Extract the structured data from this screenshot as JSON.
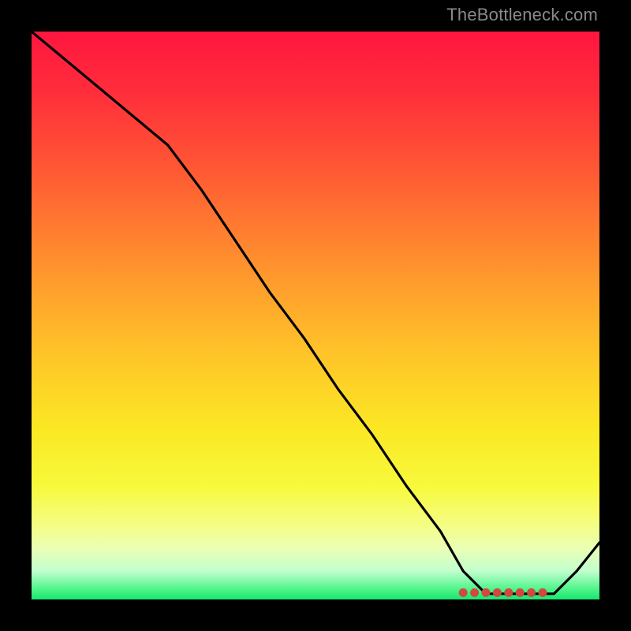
{
  "attribution": "TheBottleneck.com",
  "colors": {
    "frame_bg": "#000000",
    "curve_stroke": "#000000",
    "marker_stroke": "#d1493e",
    "marker_fill": "#d1493e",
    "attribution_text": "#8a8a8a"
  },
  "chart_data": {
    "type": "line",
    "title": "",
    "xlabel": "",
    "ylabel": "",
    "xlim": [
      0,
      100
    ],
    "ylim": [
      0,
      100
    ],
    "grid": false,
    "legend": false,
    "series": [
      {
        "name": "bottleneck-curve",
        "x": [
          0,
          6,
          12,
          18,
          24,
          30,
          36,
          42,
          48,
          54,
          60,
          66,
          72,
          76,
          80,
          84,
          88,
          92,
          96,
          100
        ],
        "y": [
          100,
          95,
          90,
          85,
          80,
          72,
          63,
          54,
          46,
          37,
          29,
          20,
          12,
          5,
          1,
          1,
          1,
          1,
          5,
          10
        ]
      }
    ],
    "markers": {
      "name": "highlight-region",
      "x": [
        76,
        78,
        80,
        82,
        84,
        86,
        88,
        90
      ],
      "y": [
        1.2,
        1.2,
        1.2,
        1.2,
        1.2,
        1.2,
        1.2,
        1.2
      ]
    },
    "gradient_meaning": "background vertical gradient from red (high bottleneck) at top through orange / yellow to green (optimal) at bottom"
  }
}
